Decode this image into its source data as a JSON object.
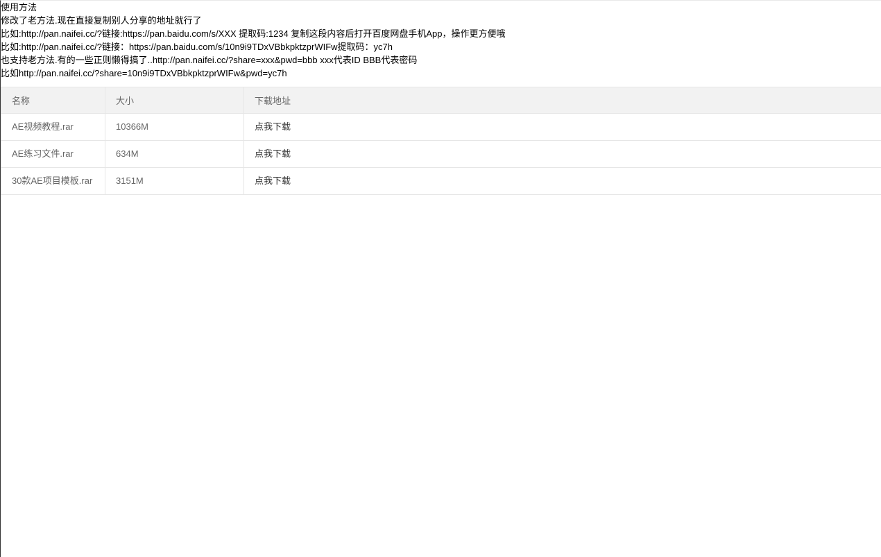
{
  "instructions": {
    "heading": "使用方法",
    "lines": [
      "修改了老方法.现在直接复制别人分享的地址就行了",
      "比如:http://pan.naifei.cc/?链接:https://pan.baidu.com/s/XXX 提取码:1234 复制这段内容后打开百度网盘手机App，操作更方便哦",
      "比如:http://pan.naifei.cc/?链接：https://pan.baidu.com/s/10n9i9TDxVBbkpktzprWIFw提取码：yc7h",
      "也支持老方法.有的一些正则懒得搞了..http://pan.naifei.cc/?share=xxx&pwd=bbb xxx代表ID BBB代表密码",
      "比如http://pan.naifei.cc/?share=10n9i9TDxVBbkpktzprWIFw&pwd=yc7h"
    ]
  },
  "table": {
    "headers": {
      "name": "名称",
      "size": "大小",
      "link": "下载地址"
    },
    "rows": [
      {
        "name": "AE视频教程.rar",
        "size": "10366M",
        "link": "点我下载"
      },
      {
        "name": "AE练习文件.rar",
        "size": "634M",
        "link": "点我下载"
      },
      {
        "name": "30款AE项目模板.rar",
        "size": "3151M",
        "link": "点我下载"
      }
    ]
  }
}
